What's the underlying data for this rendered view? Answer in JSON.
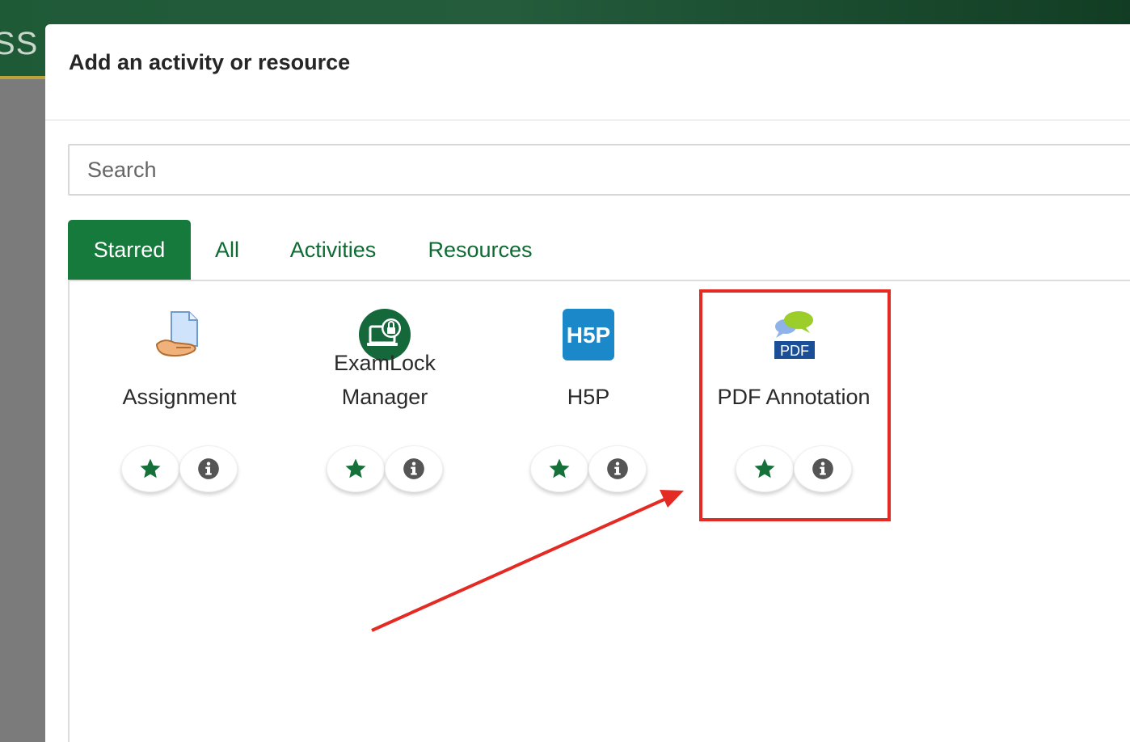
{
  "background": {
    "brand_fragment": "SS"
  },
  "modal": {
    "title": "Add an activity or resource",
    "search": {
      "placeholder": "Search",
      "value": ""
    },
    "tabs": [
      {
        "label": "Starred",
        "active": true
      },
      {
        "label": "All",
        "active": false
      },
      {
        "label": "Activities",
        "active": false
      },
      {
        "label": "Resources",
        "active": false
      }
    ],
    "items": [
      {
        "name": "Assignment",
        "icon": "assignment-icon"
      },
      {
        "name_line1": "ExamLock",
        "name_line2": "Manager",
        "icon": "examlock-icon"
      },
      {
        "name": "H5P",
        "icon": "h5p-icon",
        "icon_text": "H5P"
      },
      {
        "name": "PDF Annotation",
        "icon": "pdf-annotation-icon",
        "icon_text": "PDF"
      }
    ]
  },
  "colors": {
    "accent_green": "#157a3c",
    "star_green": "#16703a",
    "annotation_red": "#e42b23"
  }
}
